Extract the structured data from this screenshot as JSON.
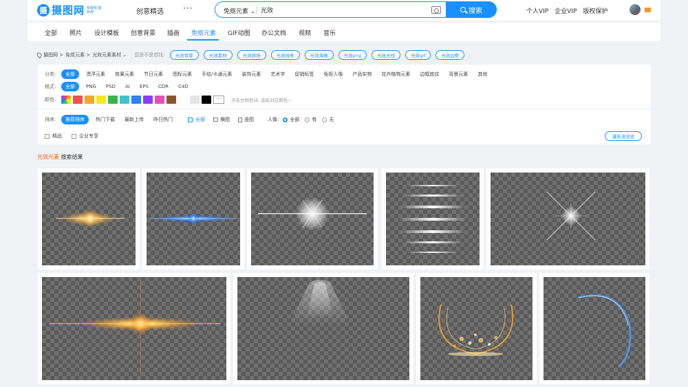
{
  "header": {
    "logo_mark": "摄",
    "logo_text": "摄图网",
    "logo_sub": "有版权 能商用",
    "nav_featured": "创意精选",
    "nav_more": "···",
    "search": {
      "category": "免抠元素",
      "value": "光效",
      "button": "搜索"
    },
    "links": [
      "个人VIP",
      "企业VIP",
      "版权保护"
    ]
  },
  "categories": [
    "全部",
    "照片",
    "设计模板",
    "创意背景",
    "插画",
    "免抠元素",
    "GIF动图",
    "办公文档",
    "视频",
    "音乐"
  ],
  "active_category": "免抠元素",
  "breadcrumb": {
    "items": [
      "摄图网 >",
      "免抠元素 >",
      "光效元素素材 ⌄"
    ],
    "guess_label": "您是不是想找:",
    "tags": [
      "光效背景",
      "光效素材",
      "光效烘场",
      "光效线条",
      "光效海报",
      "光效png",
      "光效光线",
      "光效gif",
      "光效边框"
    ]
  },
  "filters": {
    "classify_label": "分类:",
    "classify": [
      "全部",
      "漂浮元素",
      "效果元素",
      "节日元素",
      "图标元素",
      "手绘/卡通元素",
      "装饰元素",
      "艺术字",
      "促销标签",
      "免抠人像",
      "产品实物",
      "花卉植物元素",
      "边框底纹",
      "背景元素",
      "其他"
    ],
    "format_label": "格式:",
    "formats": [
      "全部",
      "PNG",
      "PSD",
      "AI",
      "EPS",
      "CDR",
      "C4D"
    ],
    "color_label": "颜色:",
    "colors": [
      "#ffffff",
      "#f05050",
      "#f5a623",
      "#f8e71c",
      "#3bb54a",
      "#3fc1c9",
      "#2f7ff5",
      "#8b3dff",
      "#e54fb6",
      "#8b572a",
      "#ffffff",
      "#e5e5e5",
      "#000000"
    ],
    "color_more": "···",
    "color_hint": "点击左侧色块, 选取对应颜色~",
    "sort_label": "排序:",
    "sorts": [
      "推荐排序",
      "热门下载",
      "最新上传",
      "昨日热门"
    ],
    "orient": [
      "全部",
      "横图",
      "竖图"
    ],
    "portrait_label": "人像:",
    "portrait": [
      "全部",
      "有",
      "无"
    ],
    "extra": [
      "精品",
      "企业专享"
    ],
    "waterfall": "瀑布流浏览"
  },
  "results": {
    "keyword": "光效元素",
    "suffix": "搜索结果"
  }
}
